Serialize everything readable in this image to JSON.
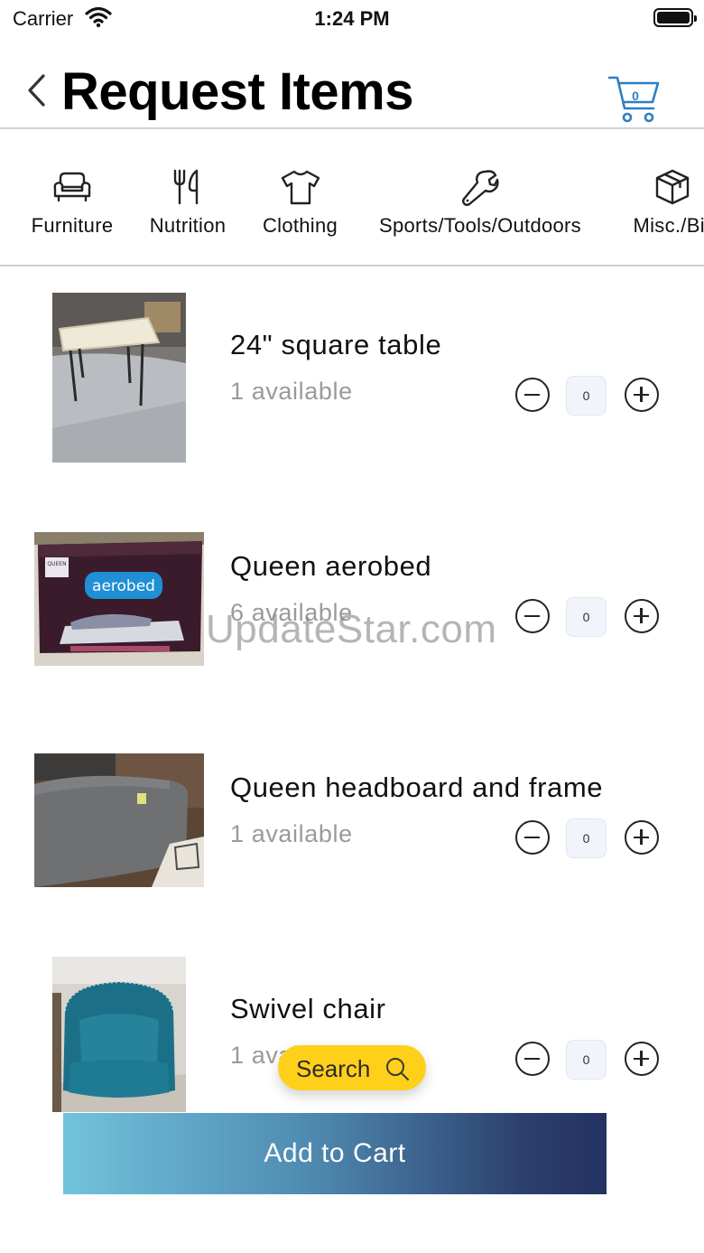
{
  "status_bar": {
    "carrier": "Carrier",
    "time": "1:24 PM"
  },
  "header": {
    "title": "Request Items",
    "cart_count": "0"
  },
  "categories": [
    {
      "label": "Furniture",
      "icon": "sofa-icon"
    },
    {
      "label": "Nutrition",
      "icon": "fork-knife-icon"
    },
    {
      "label": "Clothing",
      "icon": "shirt-icon"
    },
    {
      "label": "Sports/Tools/Outdoors",
      "icon": "wrench-icon"
    },
    {
      "label": "Misc./Bir",
      "icon": "box-icon"
    }
  ],
  "items": [
    {
      "name": "24\" square table",
      "availability": "1 available",
      "quantity": "0"
    },
    {
      "name": "Queen aerobed",
      "availability": "6 available",
      "quantity": "0",
      "image_text": {
        "brand": "aerobed",
        "tag": "QUEEN"
      }
    },
    {
      "name": "Queen headboard and frame",
      "availability": "1 available",
      "quantity": "0"
    },
    {
      "name": "Swivel chair",
      "availability": "1 available",
      "quantity": "0"
    }
  ],
  "watermark": "UpdateStar.com",
  "search_button": {
    "label": "Search"
  },
  "add_to_cart_button": {
    "label": "Add to Cart"
  },
  "colors": {
    "search_pill": "#ffd01a",
    "cart_accent": "#2f7fc2",
    "button_gradient_start": "#71c3dd",
    "button_gradient_end": "#233260"
  }
}
